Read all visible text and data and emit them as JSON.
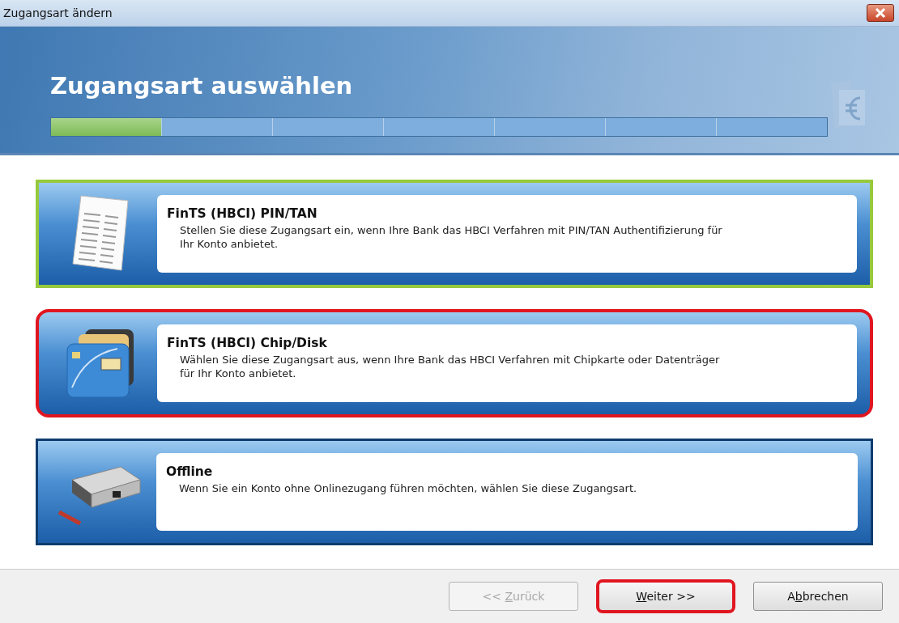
{
  "window": {
    "title": "Zugangsart ändern"
  },
  "header": {
    "title": "Zugangsart auswählen",
    "progress": {
      "level": 0.143
    }
  },
  "options": [
    {
      "kind": "pin-tan",
      "title": "FinTS (HBCI) PIN/TAN",
      "description": "Stellen Sie diese Zugangsart ein, wenn Ihre Bank das HBCI Verfahren mit PIN/TAN Authentifizierung für Ihr Konto anbietet.",
      "selected": true,
      "highlighted": false
    },
    {
      "kind": "chip-disk",
      "title": "FinTS (HBCI) Chip/Disk",
      "description": "Wählen Sie diese Zugangsart aus, wenn Ihre Bank das HBCI Verfahren mit Chipkarte oder Datenträger für Ihr Konto anbietet.",
      "selected": false,
      "highlighted": true
    },
    {
      "kind": "offline",
      "title": "Offline",
      "description": "Wenn Sie ein Konto ohne Onlinezugang führen möchten, wählen Sie diese Zugangsart.",
      "selected": false,
      "highlighted": false
    }
  ],
  "buttons": [
    {
      "before": "<< ",
      "key": "Z",
      "after": "urück",
      "disabled": true,
      "highlighted": false
    },
    {
      "key": "W",
      "after": "eiter >>",
      "disabled": false,
      "highlighted": true
    },
    {
      "before": "A",
      "key": "b",
      "after": "brechen",
      "disabled": false,
      "highlighted": false
    }
  ]
}
